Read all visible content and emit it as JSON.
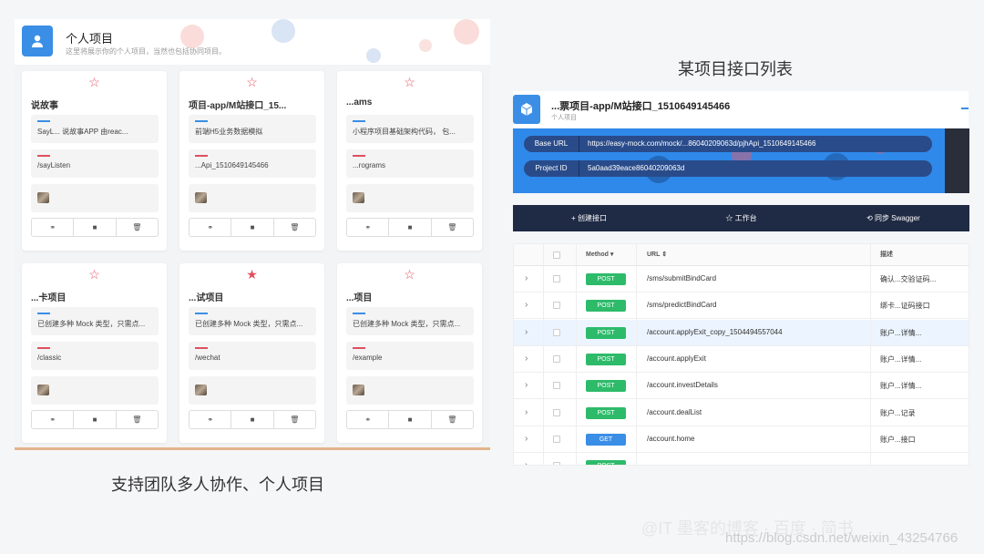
{
  "left": {
    "title": "个人项目",
    "subtitle": "这里将展示你的个人项目，当然也包括协同项目。",
    "caption": "支持团队多人协作、个人项目",
    "cards": [
      {
        "title": "说故事",
        "desc": "SayL... 说故事APP 由reac...",
        "base": "/sayListen",
        "starred": false
      },
      {
        "title": "项目-app/M站接口_15...",
        "desc": "前端H5业务数据模拟",
        "base": "...Api_1510649145466",
        "starred": false
      },
      {
        "title": "...ams",
        "desc": "小程序项目基础架构代码， 包...",
        "base": "...rograms",
        "starred": false
      },
      {
        "title": "...卡项目",
        "desc": "已创建多种 Mock 类型，只需点...",
        "base": "/classic",
        "starred": false
      },
      {
        "title": "...试项目",
        "desc": "已创建多种 Mock 类型，只需点...",
        "base": "/wechat",
        "starred": true
      },
      {
        "title": "...项目",
        "desc": "已创建多种 Mock 类型，只需点...",
        "base": "/example",
        "starred": false
      }
    ]
  },
  "right": {
    "caption": "某项目接口列表",
    "project_title": "...票项目-app/M站接口_1510649145466",
    "project_sub": "个人项目",
    "base_url_label": "Base URL",
    "base_url_value": "https://easy-mock.com/mock/...86040209063d/pjhApi_1510649145466",
    "project_id_label": "Project ID",
    "project_id_value": "5a0aad39eace86040209063d",
    "toolbar": {
      "create": "+ 创建接口",
      "workspace": "☆ 工作台",
      "sync": "⟲ 同步 Swagger"
    },
    "table": {
      "col_method": "Method",
      "col_url": "URL",
      "col_desc": "描述",
      "rows": [
        {
          "method": "POST",
          "url": "/sms/submitBindCard",
          "desc": "确认...交验证码..."
        },
        {
          "method": "POST",
          "url": "/sms/predictBindCard",
          "desc": "绑卡...证码接口"
        },
        {
          "method": "POST",
          "url": "/account.applyExit_copy_1504494557044",
          "desc": "账户...详情..."
        },
        {
          "method": "POST",
          "url": "/account.applyExit",
          "desc": "账户...详情..."
        },
        {
          "method": "POST",
          "url": "/account.investDetails",
          "desc": "账户...详情..."
        },
        {
          "method": "POST",
          "url": "/account.dealList",
          "desc": "账户...记录"
        },
        {
          "method": "GET",
          "url": "/account.home",
          "desc": "账户...接口"
        },
        {
          "method": "POST",
          "url": "",
          "desc": ""
        }
      ]
    }
  },
  "watermark": "https://blog.csdn.net/weixin_43254766",
  "colors": {
    "accent": "#3a8ee6",
    "post": "#2dbb6a",
    "get": "#3a8ee6",
    "star": "#e04f5f",
    "toolbar": "#1f2a44"
  }
}
